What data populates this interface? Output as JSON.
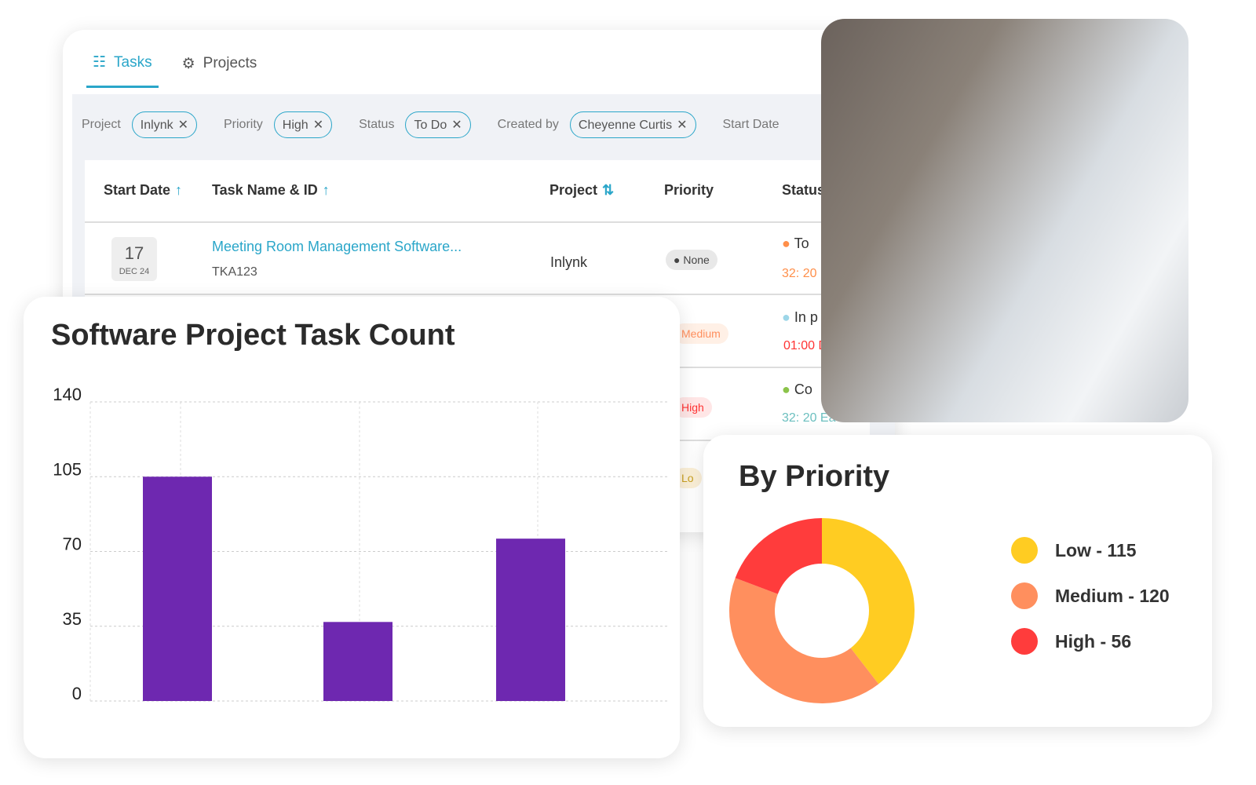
{
  "tabs": [
    {
      "label": "Tasks",
      "icon": "task-list-icon",
      "active": true
    },
    {
      "label": "Projects",
      "icon": "project-settings-icon",
      "active": false
    }
  ],
  "filters": [
    {
      "label": "Project",
      "value": "Inlynk"
    },
    {
      "label": "Priority",
      "value": "High"
    },
    {
      "label": "Status",
      "value": "To Do"
    },
    {
      "label": "Created by",
      "value": "Cheyenne Curtis"
    },
    {
      "label": "Start Date",
      "value": ""
    }
  ],
  "table": {
    "headers": [
      "Start Date",
      "Task Name & ID",
      "Project",
      "Priority",
      "Status"
    ],
    "row": {
      "day": "17",
      "month": "DEC 24",
      "name": "Meeting Room Management Software...",
      "id": "TKA123",
      "project": "Inlynk",
      "priority": "None",
      "status": "To",
      "time": "32: 20"
    },
    "partial": [
      {
        "priority": "Medium",
        "status": "In p",
        "time": "01:00 D"
      },
      {
        "priority": "High",
        "status": "Co",
        "time": "32: 20 Ea"
      },
      {
        "priority": "Lo"
      }
    ]
  },
  "colors": {
    "accent": "#2aa6c9",
    "bar": "#6e28b0",
    "low": "#ffcc22",
    "medium": "#ff8f5e",
    "high": "#ff3c3c"
  },
  "chart_data": [
    {
      "type": "bar",
      "title": "Software Project Task Count",
      "categories": [
        "",
        "",
        ""
      ],
      "values": [
        105,
        37,
        76
      ],
      "ylim": [
        0,
        140
      ],
      "yticks": [
        0,
        35,
        70,
        105,
        140
      ],
      "grid": true,
      "xlabel": "",
      "ylabel": ""
    },
    {
      "type": "pie",
      "title": "By Priority",
      "donut": true,
      "labels": [
        "Low - 115",
        "Medium - 120",
        "High - 56"
      ],
      "values": [
        115,
        120,
        56
      ],
      "colors": [
        "#ffcc22",
        "#ff8f5e",
        "#ff3c3c"
      ],
      "legend": "right"
    }
  ]
}
